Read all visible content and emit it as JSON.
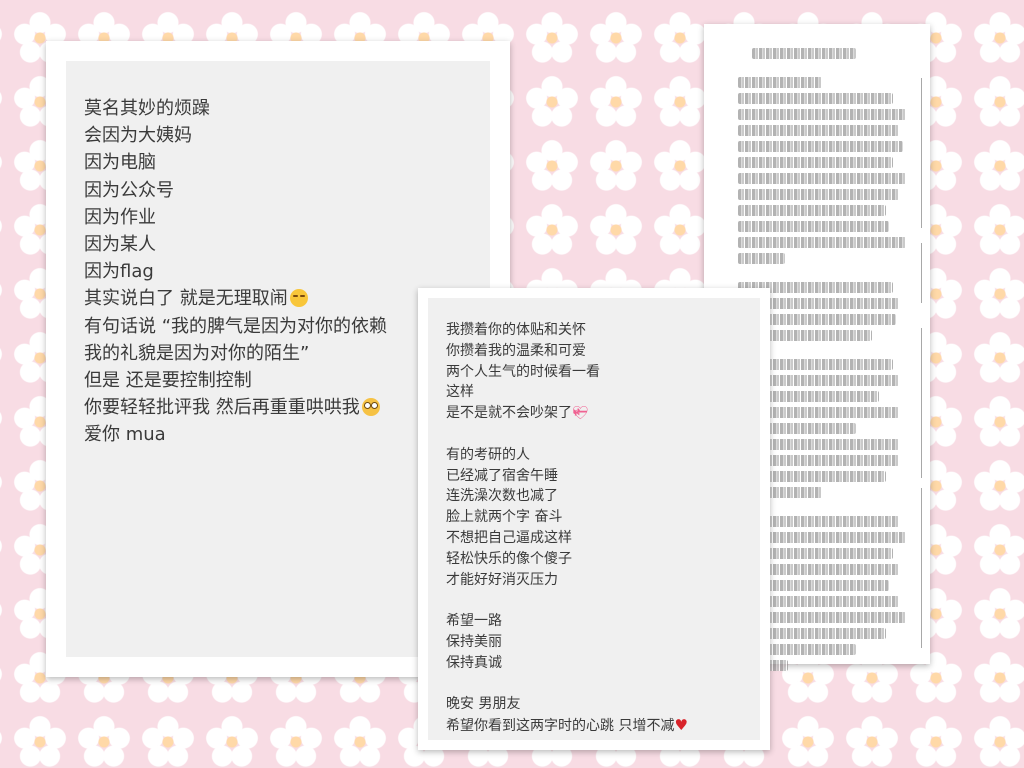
{
  "left_note": {
    "lines": [
      "莫名其妙的烦躁",
      "会因为大姨妈",
      "因为电脑",
      "因为公众号",
      "因为作业",
      "因为某人",
      "因为flag",
      "其实说白了 就是无理取闹",
      "有句话说 “我的脾气是因为对你的依赖",
      "我的礼貌是因为对你的陌生”",
      "但是 还是要控制控制",
      "你要轻轻批评我 然后再重重哄哄我",
      "爱你 mua"
    ]
  },
  "mid_note": {
    "lines": [
      "我攒着你的体贴和关怀",
      "你攒着我的温柔和可爱",
      "两个人生气的时候看一看",
      "这样",
      "是不是就不会吵架了",
      "",
      "有的考研的人",
      "已经减了宿舍午睡",
      "连洗澡次数也减了",
      "脸上就两个字 奋斗",
      "不想把自己逼成这样",
      "轻松快乐的像个傻子",
      "才能好好消灭压力",
      "",
      "希望一路",
      "保持美丽",
      "保持真诚",
      "",
      "晚安 男朋友",
      "希望你看到这两字时的心跳 只增不减"
    ]
  },
  "icons": {
    "laugh": "face-with-tears-of-joy-icon",
    "flushed": "flushed-face-icon",
    "heart_ribbon": "heart-with-ribbon-icon",
    "red_heart": "red-heart-icon"
  },
  "colors": {
    "background": "#f8dce4",
    "card": "#ffffff",
    "note_bg": "#f0f0f0",
    "text": "#3a3a3a"
  }
}
